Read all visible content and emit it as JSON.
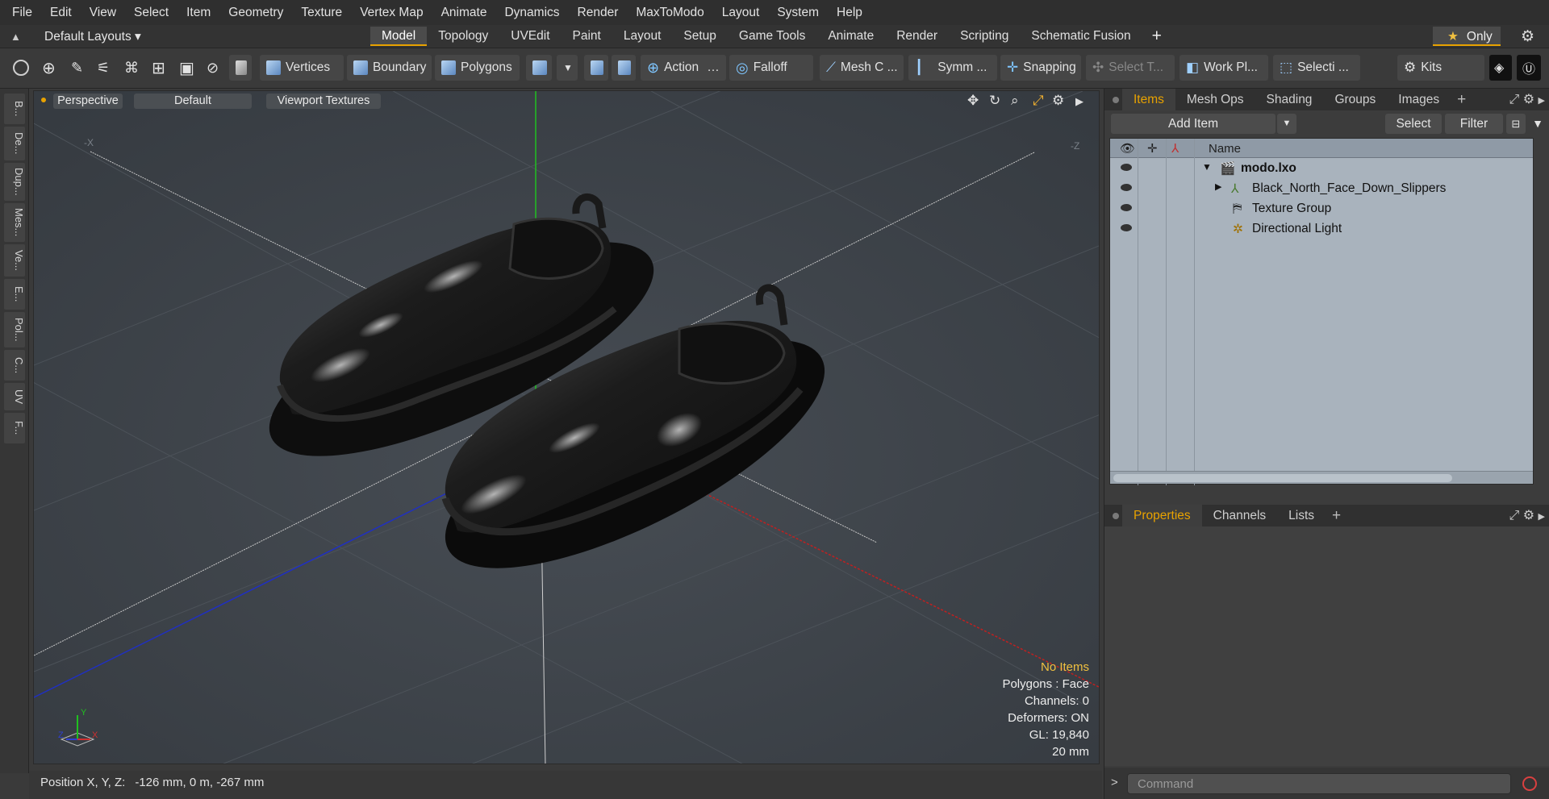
{
  "menu": [
    "File",
    "Edit",
    "View",
    "Select",
    "Item",
    "Geometry",
    "Texture",
    "Vertex Map",
    "Animate",
    "Dynamics",
    "Render",
    "MaxToModo",
    "Layout",
    "System",
    "Help"
  ],
  "layout": {
    "default_layouts": "Default Layouts",
    "tabs": [
      "Model",
      "Topology",
      "UVEdit",
      "Paint",
      "Layout",
      "Setup",
      "Game Tools",
      "Animate",
      "Render",
      "Scripting",
      "Schematic Fusion"
    ],
    "active_tab": "Model",
    "only_label": "Only"
  },
  "toolbar": {
    "vertices": "Vertices",
    "boundary": "Boundary",
    "polygons": "Polygons",
    "action": "Action",
    "falloff": "Falloff",
    "mesh_c": "Mesh C ...",
    "symm": "Symm ...",
    "snapping": "Snapping",
    "select_t": "Select T...",
    "work_pl": "Work Pl...",
    "selecti": "Selecti ...",
    "kits": "Kits"
  },
  "left_tabs": [
    "B...",
    "De...",
    "Dup...",
    "Mes...",
    "Ve...",
    "E...",
    "Pol...",
    "C...",
    "UV",
    "F..."
  ],
  "viewport": {
    "perspective": "Perspective",
    "default": "Default",
    "textures": "Viewport Textures",
    "info": {
      "no_items": "No Items",
      "polygons": "Polygons : Face",
      "channels": "Channels: 0",
      "deformers": "Deformers: ON",
      "gl": "GL: 19,840",
      "scale": "20 mm"
    },
    "axis_labels": {
      "x": "X",
      "y": "Y",
      "z": "Z"
    },
    "corner_labels": {
      "neg_x": "-X",
      "neg_z": "-Z"
    }
  },
  "status": {
    "label": "Position X, Y, Z:",
    "value": "-126 mm, 0 m, -267 mm"
  },
  "items_panel": {
    "tabs": [
      "Items",
      "Mesh Ops",
      "Shading",
      "Groups",
      "Images"
    ],
    "active_tab": "Items",
    "add_item": "Add Item",
    "select": "Select",
    "filter": "Filter",
    "col_name": "Name",
    "rows": [
      {
        "name": "modo.lxo"
      },
      {
        "name": "Black_North_Face_Down_Slippers"
      },
      {
        "name": "Texture Group"
      },
      {
        "name": "Directional Light"
      }
    ]
  },
  "props_panel": {
    "tabs": [
      "Properties",
      "Channels",
      "Lists"
    ],
    "active_tab": "Properties"
  },
  "command": {
    "placeholder": "Command"
  },
  "colors": {
    "accent": "#e8a200",
    "viewport_bg": "#3c4248",
    "x_axis": "#c02020",
    "y_axis": "#20c020",
    "z_axis": "#2030c0"
  }
}
